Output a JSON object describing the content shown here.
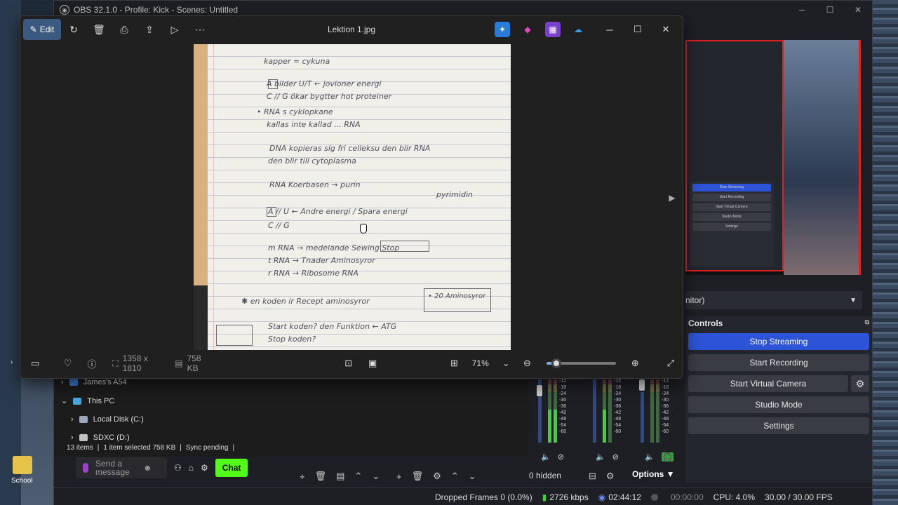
{
  "desktop": {
    "folder_label": "School"
  },
  "obs": {
    "title": "OBS 32.1.0 - Profile: Kick - Scenes: Untitled",
    "source_label": "nitor)",
    "controls": {
      "title": "Controls",
      "stop_streaming": "Stop Streaming",
      "start_recording": "Start Recording",
      "start_virtual_camera": "Start Virtual Camera",
      "studio_mode": "Studio Mode",
      "settings": "Settings"
    },
    "preview_mini": {
      "controls": "Controls",
      "buttons": [
        "Stop Streaming",
        "Start Recording",
        "Start Virtual Camera",
        "Studio Mode",
        "Settings"
      ],
      "status": "CPU: 4.0%   30.00 / 30.00 FPS",
      "source": "nitor)"
    },
    "mixer": {
      "scale": [
        "-12",
        "-18",
        "-24",
        "-30",
        "-36",
        "-42",
        "-48",
        "-54",
        "-60"
      ],
      "hidden_label": "0 hidden",
      "options_label": "Options"
    },
    "status": {
      "dropped_frames": "Dropped Frames 0 (0.0%)",
      "bitrate": "2726 kbps",
      "stream_time": "02:44:12",
      "rec_time": "00:00:00",
      "cpu": "CPU: 4.0%",
      "fps": "30.00 / 30.00 FPS"
    },
    "colors": {
      "accent": "#2d54d6",
      "preview_border": "#e02020"
    }
  },
  "explorer": {
    "tree": [
      "James's A54",
      "This PC",
      "Local Disk (C:)",
      "SDXC (D:)"
    ],
    "status": {
      "items": "13 items",
      "selected": "1 item selected  758 KB",
      "sync": "Sync pending"
    }
  },
  "chat": {
    "placeholder": "Send a message",
    "button": "Chat",
    "accent": "#53fc18"
  },
  "photos": {
    "edit_label": "Edit",
    "file_title": "Lektion 1.jpg",
    "dimensions": "1358 x 1810",
    "file_size": "758 KB",
    "zoom": "71%",
    "zoom_fraction": 0.14,
    "handwriting": [
      "kapper = cykuna",
      "A  bilder  U/T  ←  jovioner  energi",
      "C  //  G    ökar bygtter hot proteiner",
      "• RNA s cyklopkane",
      "kallas inte kallad ... RNA",
      "DNA kopieras sig fri celleksu den blir RNA",
      "den blir till cytoplasma",
      "RNA          Koerbasen → purin",
      "pyrimidin",
      "A  //  U  ←  Andre energi / Spara energi",
      "C  //  G",
      "m RNA → medelande   Sewing  Stop",
      "t RNA → Tnader        Aminosyror",
      "r RNA → Ribosome RNA",
      "✱ en koden ir Recept aminosyror",
      "• 20 Aminosyror",
      "Start koden?  den Funktion ← ATG",
      "Stop koden?"
    ]
  }
}
